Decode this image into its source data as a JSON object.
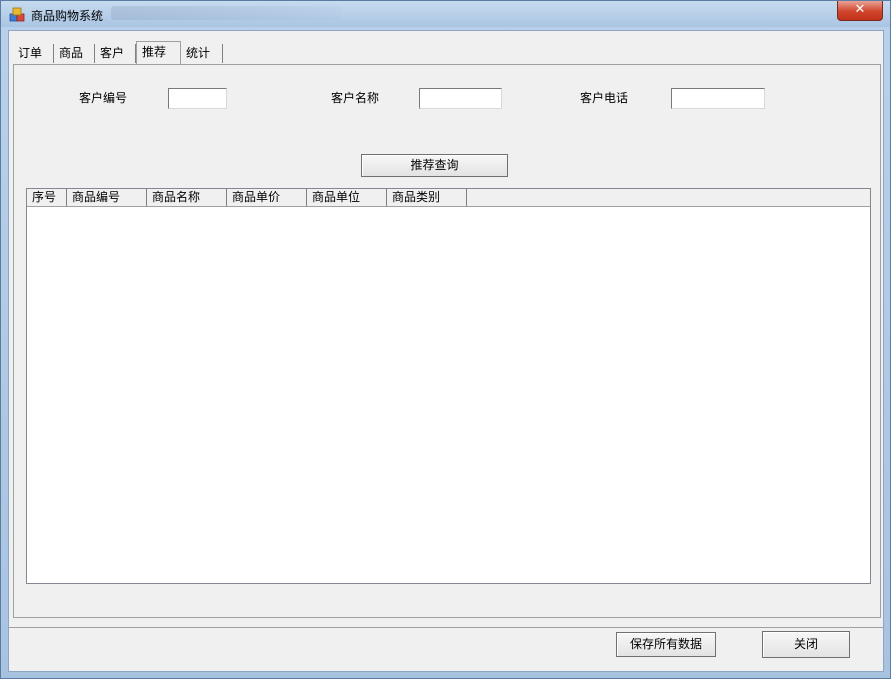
{
  "window": {
    "title": "商品购物系统",
    "close_label": "✕"
  },
  "tabs": [
    {
      "label": "订单"
    },
    {
      "label": "商品"
    },
    {
      "label": "客户"
    },
    {
      "label": "推荐",
      "active": true
    },
    {
      "label": "统计"
    }
  ],
  "form": {
    "customer_id_label": "客户编号",
    "customer_id_value": "",
    "customer_name_label": "客户名称",
    "customer_name_value": "",
    "customer_phone_label": "客户电话",
    "customer_phone_value": "",
    "query_button": "推荐查询"
  },
  "table": {
    "columns": [
      "序号",
      "商品编号",
      "商品名称",
      "商品单价",
      "商品单位",
      "商品类别"
    ],
    "rows": []
  },
  "footer": {
    "save_all_button": "保存所有数据",
    "close_button": "关闭"
  },
  "icons": {
    "app": "app-icon",
    "close": "close-icon"
  }
}
